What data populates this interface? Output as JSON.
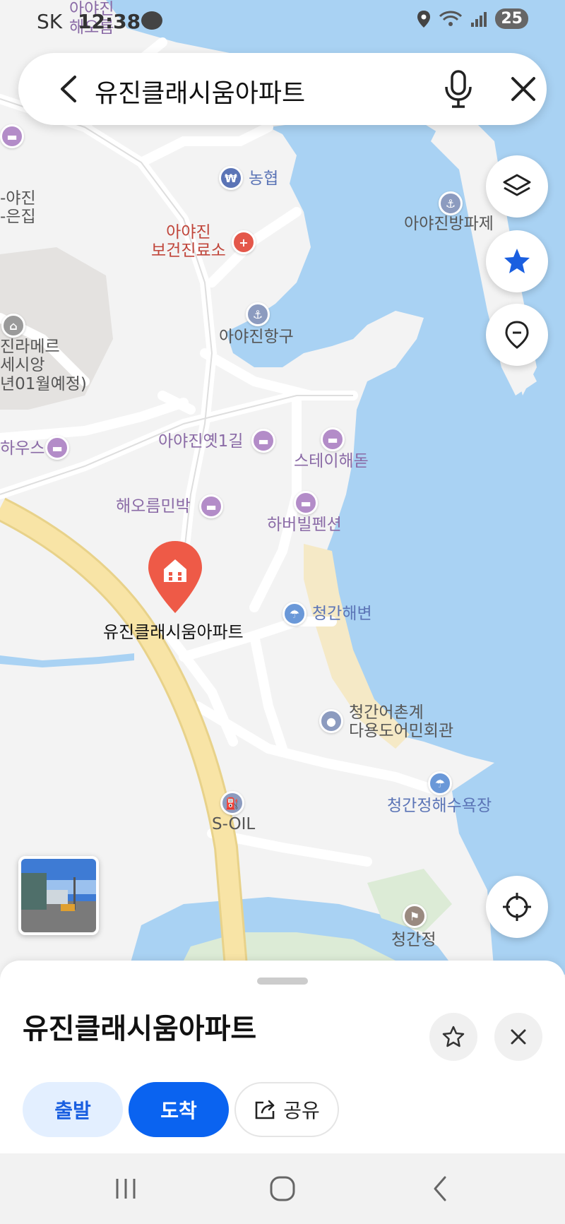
{
  "status_bar": {
    "carrier": "SK",
    "time": "12:38",
    "battery": "25"
  },
  "search": {
    "query": "유진클래시움아파트"
  },
  "map_labels": {
    "nonghyup": "농협",
    "health_center_1": "아야진",
    "health_center_2": "보건진료소",
    "breakwater": "아야진방파제",
    "port": "아야진항구",
    "ayajin_left_1": "-야진",
    "ayajin_left_2": "-은집",
    "lamere_1": "진라메르",
    "lamere_2": "세시앙",
    "lamere_3": "년01월예정)",
    "top_cut_1": "아야진",
    "top_cut_2": "해오름",
    "house": "하우스",
    "old_road": "아야진옛1길",
    "stay": "스테이해돋",
    "haeoreum": "해오름민박",
    "harbor_pension": "하버빌펜션",
    "beach": "청간해변",
    "selected_place": "유진클래시움아파트",
    "fishing_1": "청간어촌계",
    "fishing_2": "다용도어민회관",
    "soil": "S-OIL",
    "beach2": "청간정해수욕장",
    "pavilion": "청간정"
  },
  "sheet": {
    "title": "유진클래시움아파트",
    "start_label": "출발",
    "arrive_label": "도착",
    "share_label": "공유"
  },
  "colors": {
    "sea": "#a9d2f3",
    "accent": "#0a63f0",
    "pin": "#ee5a47",
    "road_main": "#f8e4a6"
  }
}
